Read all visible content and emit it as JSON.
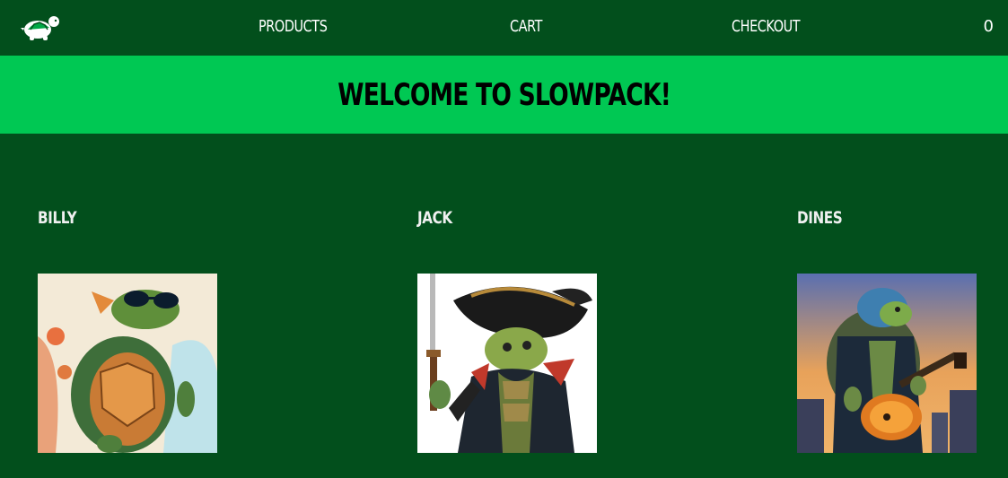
{
  "nav": {
    "logo_icon": "turtle-logo-icon",
    "links": [
      {
        "label": "Products"
      },
      {
        "label": "Cart"
      },
      {
        "label": "Checkout"
      }
    ],
    "cart_count": "0"
  },
  "banner": {
    "title": "Welcome to Slowpack!"
  },
  "products": [
    {
      "name": "Billy",
      "image_icon": "turtle-sunglasses-image"
    },
    {
      "name": "Jack",
      "image_icon": "turtle-pirate-image"
    },
    {
      "name": "Dines",
      "image_icon": "turtle-guitarist-image"
    }
  ],
  "colors": {
    "nav_bg": "#024f1c",
    "banner_bg": "#00c853",
    "page_bg": "#024f1c"
  }
}
